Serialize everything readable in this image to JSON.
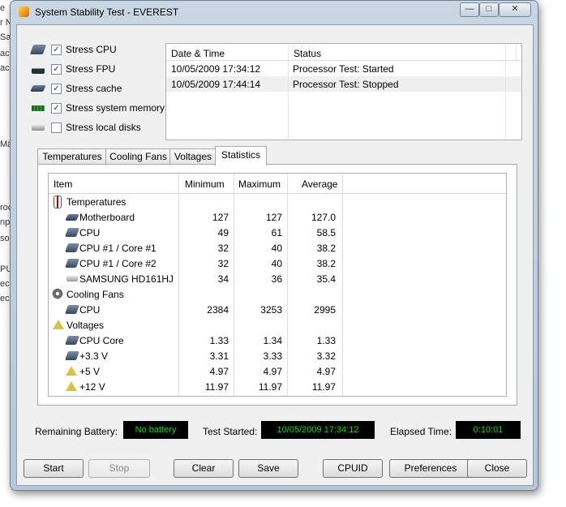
{
  "background_text": [
    "e",
    "r N",
    "Sa",
    "ach",
    "ache",
    "Mä",
    "roc",
    "npr",
    "sol",
    "PU",
    "ec",
    "ec"
  ],
  "window": {
    "title": "System Stability Test - EVEREST",
    "controls": {
      "minimize": "—",
      "maximize": "□",
      "close": "✕"
    }
  },
  "stress_options": [
    {
      "label": "Stress CPU",
      "checked": true,
      "icon": "cpu-chip-icon"
    },
    {
      "label": "Stress FPU",
      "checked": true,
      "icon": "fpu-icon"
    },
    {
      "label": "Stress cache",
      "checked": true,
      "icon": "cache-chip-icon"
    },
    {
      "label": "Stress system memory",
      "checked": true,
      "icon": "memory-module-icon"
    },
    {
      "label": "Stress local disks",
      "checked": false,
      "icon": "disk-drive-icon"
    }
  ],
  "log": {
    "headers": {
      "datetime": "Date & Time",
      "status": "Status"
    },
    "rows": [
      {
        "datetime": "10/05/2009 17:34:12",
        "status": "Processor Test: Started"
      },
      {
        "datetime": "10/05/2009 17:44:14",
        "status": "Processor Test: Stopped"
      }
    ]
  },
  "tabs": [
    "Temperatures",
    "Cooling Fans",
    "Voltages",
    "Statistics"
  ],
  "active_tab": "Statistics",
  "stats": {
    "headers": {
      "item": "Item",
      "min": "Minimum",
      "max": "Maximum",
      "avg": "Average"
    },
    "rows": [
      {
        "type": "group",
        "item": "Temperatures",
        "icon": "thermometer-icon"
      },
      {
        "type": "item",
        "item": "Motherboard",
        "min": "127",
        "max": "127",
        "avg": "127.0",
        "icon": "motherboard-icon"
      },
      {
        "type": "item",
        "item": "CPU",
        "min": "49",
        "max": "61",
        "avg": "58.5",
        "icon": "cpu-chip-icon"
      },
      {
        "type": "item",
        "item": "CPU #1 / Core #1",
        "min": "32",
        "max": "40",
        "avg": "38.2",
        "icon": "cpu-chip-icon"
      },
      {
        "type": "item",
        "item": "CPU #1 / Core #2",
        "min": "32",
        "max": "40",
        "avg": "38.2",
        "icon": "cpu-chip-icon"
      },
      {
        "type": "item",
        "item": "SAMSUNG HD161HJ",
        "min": "34",
        "max": "36",
        "avg": "35.4",
        "icon": "disk-drive-icon"
      },
      {
        "type": "group",
        "item": "Cooling Fans",
        "icon": "fan-icon"
      },
      {
        "type": "item",
        "item": "CPU",
        "min": "2384",
        "max": "3253",
        "avg": "2995",
        "icon": "cpu-chip-icon"
      },
      {
        "type": "group",
        "item": "Voltages",
        "icon": "voltage-icon"
      },
      {
        "type": "item",
        "item": "CPU Core",
        "min": "1.33",
        "max": "1.34",
        "avg": "1.33",
        "icon": "cpu-chip-icon"
      },
      {
        "type": "item",
        "item": "+3.3 V",
        "min": "3.31",
        "max": "3.33",
        "avg": "3.32",
        "icon": "cpu-chip-icon"
      },
      {
        "type": "item",
        "item": "+5 V",
        "min": "4.97",
        "max": "4.97",
        "avg": "4.97",
        "icon": "voltage-icon"
      },
      {
        "type": "item",
        "item": "+12 V",
        "min": "11.97",
        "max": "11.97",
        "avg": "11.97",
        "icon": "voltage-icon"
      }
    ]
  },
  "status_bar": {
    "battery_label": "Remaining Battery:",
    "battery_value": "No battery",
    "started_label": "Test Started:",
    "started_value": "10/05/2009 17:34:12",
    "elapsed_label": "Elapsed Time:",
    "elapsed_value": "0:10:01"
  },
  "buttons": {
    "start": "Start",
    "stop": "Stop",
    "clear": "Clear",
    "save": "Save",
    "cpuid": "CPUID",
    "preferences": "Preferences",
    "close": "Close"
  },
  "colors": {
    "led_bg": "#000000",
    "led_text": "#00e000",
    "window_frame": "#c3d0de"
  }
}
